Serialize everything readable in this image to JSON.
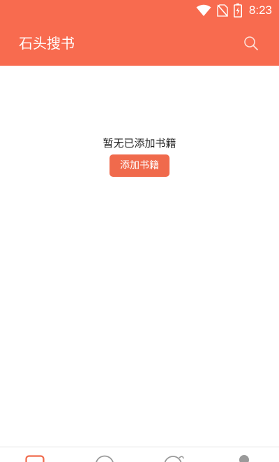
{
  "status_bar": {
    "time": "8:23",
    "icons": [
      "wifi-icon",
      "no-sim-icon",
      "battery-charging-icon"
    ]
  },
  "toolbar": {
    "title": "石头搜书",
    "search_icon": "search-icon"
  },
  "empty_state": {
    "message": "暂无已添加书籍",
    "button_label": "添加书籍"
  },
  "bottom_nav": {
    "items": [
      {
        "icon": "bookshelf-icon",
        "active": true
      },
      {
        "icon": "explore-icon",
        "active": false
      },
      {
        "icon": "discover-icon",
        "active": false
      },
      {
        "icon": "profile-icon",
        "active": false
      }
    ]
  },
  "colors": {
    "accent": "#f86b4f",
    "button": "#f06a4c",
    "inactive_icon": "#9a9a9a"
  }
}
